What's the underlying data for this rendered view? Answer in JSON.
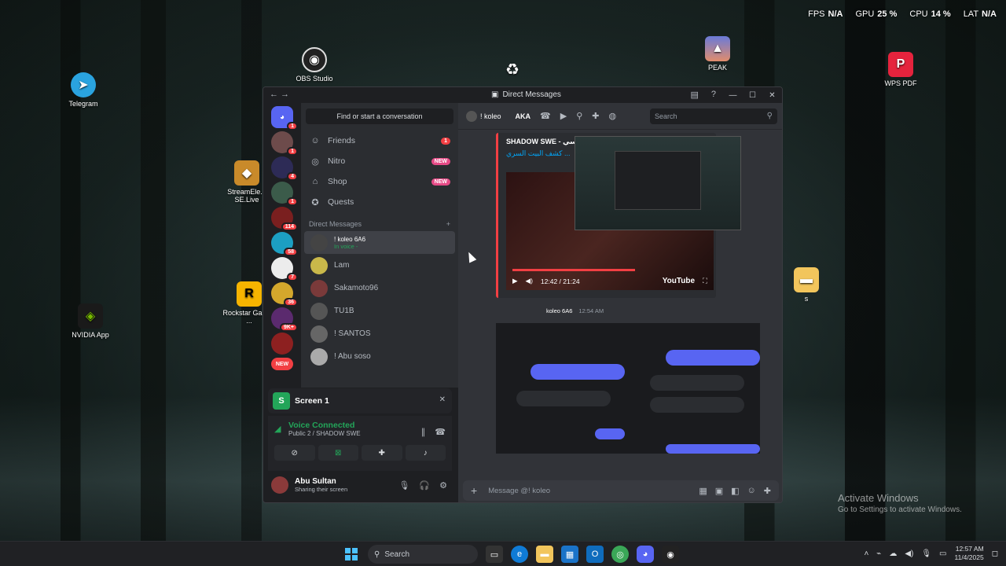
{
  "hud": {
    "fps_label": "FPS",
    "fps": "N/A",
    "gpu_label": "GPU",
    "gpu": "25 %",
    "cpu_label": "CPU",
    "cpu": "14 %",
    "lat_label": "LAT",
    "lat": "N/A"
  },
  "desktop_icons": {
    "telegram": "Telegram",
    "obs": "OBS Studio",
    "peak": "PEAK",
    "wps": "WPS PDF",
    "streamelements": "StreamEle... SE.Live",
    "rockstar": "Rockstar Games ...",
    "nvidia": "NVIDIA App",
    "folder": "s"
  },
  "activate": {
    "title": "Activate Windows",
    "sub": "Go to Settings to activate Windows."
  },
  "window": {
    "title": "Direct Messages"
  },
  "servers": {
    "badges": [
      "1",
      "1",
      "4",
      "1",
      "114",
      "58",
      "7",
      "36",
      "9K+",
      "NEW"
    ]
  },
  "dm": {
    "find": "Find or start a conversation",
    "nav": [
      {
        "label": "Friends",
        "badge": "1"
      },
      {
        "label": "Nitro",
        "badge": "NEW"
      },
      {
        "label": "Shop",
        "badge": "NEW"
      },
      {
        "label": "Quests",
        "badge": ""
      }
    ],
    "header": "Direct Messages",
    "rows": [
      {
        "name": "! koleo",
        "tag": "6A6",
        "sub": "In voice -"
      },
      {
        "name": "Lam"
      },
      {
        "name": "Sakamoto96"
      },
      {
        "name": "TU1B"
      },
      {
        "name": "! SANTOS"
      },
      {
        "name": "! Abu soso"
      }
    ]
  },
  "screen_card": {
    "title": "Screen 1"
  },
  "voice": {
    "status": "Voice Connected",
    "channel": "Public 2 / SHADOW SWE"
  },
  "user": {
    "name": "Abu Sultan",
    "status": "Sharing their screen"
  },
  "chat": {
    "head_name": "! koleo",
    "head_tag": "AKA",
    "search_placeholder": "Search",
    "embed_title": "SHADOW SWE - ساسي",
    "embed_link": "كشف البيت السري ...",
    "video_time": "12:42 / 21:24",
    "youtube": "YouTube",
    "msg_author": "koleo",
    "msg_tag": "6A6",
    "msg_time": "12:54 AM",
    "composer_placeholder": "Message @! koleo"
  },
  "taskbar": {
    "search": "Search",
    "time": "12:57 AM",
    "date": "11/4/2025"
  }
}
